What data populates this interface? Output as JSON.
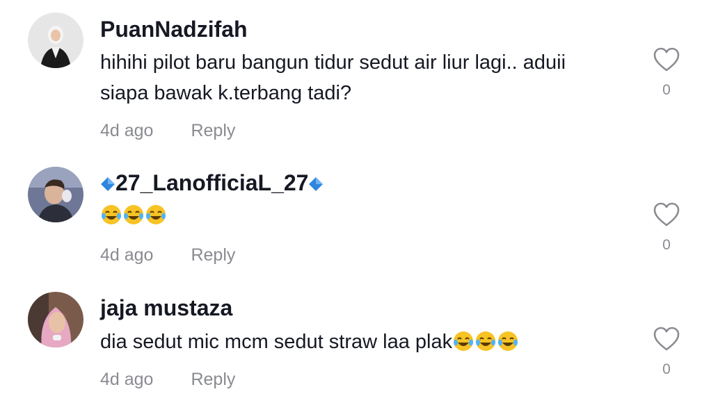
{
  "comments": [
    {
      "username": "PuanNadzifah",
      "text_lines": [
        "hihihi pilot baru bangun tidur sedut air liur lagi.. aduii",
        "siapa bawak k.terbang tadi?"
      ],
      "timestamp": "4d ago",
      "reply_label": "Reply",
      "likes": "0",
      "avatar": "avatar-hijab-black-outfit"
    },
    {
      "username": "27_LanofficiaL_27",
      "username_decoration": "blue-diamond-emoji",
      "text_emoji": [
        "face-with-tears-of-joy",
        "face-with-tears-of-joy",
        "face-with-tears-of-joy"
      ],
      "timestamp": "4d ago",
      "reply_label": "Reply",
      "likes": "0",
      "avatar": "avatar-young-man-selfie"
    },
    {
      "username": "jaja mustaza",
      "text": "dia sedut mic mcm sedut straw laa plak",
      "text_emoji": [
        "face-with-tears-of-joy",
        "face-with-tears-of-joy",
        "face-with-tears-of-joy"
      ],
      "timestamp": "4d ago",
      "reply_label": "Reply",
      "likes": "0",
      "avatar": "avatar-pink-hijab"
    }
  ],
  "colors": {
    "text": "#161823",
    "secondary": "#8a8b91",
    "diamond": "#2e86de"
  }
}
